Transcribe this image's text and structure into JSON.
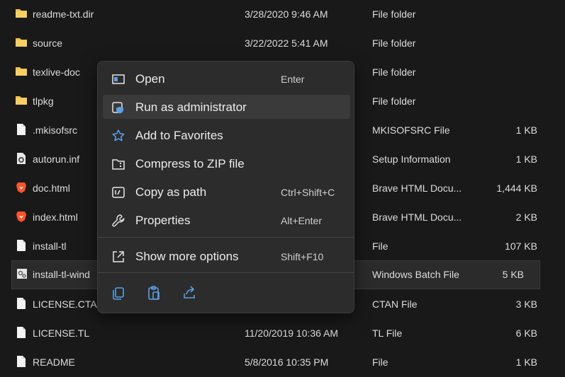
{
  "files": [
    {
      "name": "readme-txt.dir",
      "date": "3/28/2020 9:46 AM",
      "type": "File folder",
      "size": "",
      "icon": "folder-icon"
    },
    {
      "name": "source",
      "date": "3/22/2022 5:41 AM",
      "type": "File folder",
      "size": "",
      "icon": "folder-icon"
    },
    {
      "name": "texlive-doc",
      "date": "",
      "type": "File folder",
      "size": "",
      "icon": "folder-icon"
    },
    {
      "name": "tlpkg",
      "date": "",
      "type": "File folder",
      "size": "",
      "icon": "folder-icon"
    },
    {
      "name": ".mkisofsrc",
      "date": "",
      "type": "MKISOFSRC File",
      "size": "1 KB",
      "icon": "file-icon"
    },
    {
      "name": "autorun.inf",
      "date": "",
      "type": "Setup Information",
      "size": "1 KB",
      "icon": "settings-file-icon"
    },
    {
      "name": "doc.html",
      "date": "",
      "type": "Brave HTML Docu...",
      "size": "1,444 KB",
      "icon": "brave-icon"
    },
    {
      "name": "index.html",
      "date": "",
      "type": "Brave HTML Docu...",
      "size": "2 KB",
      "icon": "brave-icon"
    },
    {
      "name": "install-tl",
      "date": "",
      "type": "File",
      "size": "107 KB",
      "icon": "file-icon"
    },
    {
      "name": "install-tl-wind",
      "date": "",
      "type": "Windows Batch File",
      "size": "5 KB",
      "icon": "batch-file-icon"
    },
    {
      "name": "LICENSE.CTAN",
      "date": "",
      "type": "CTAN File",
      "size": "3 KB",
      "icon": "file-icon"
    },
    {
      "name": "LICENSE.TL",
      "date": "11/20/2019 10:36 AM",
      "type": "TL File",
      "size": "6 KB",
      "icon": "file-icon"
    },
    {
      "name": "README",
      "date": "5/8/2016 10:35 PM",
      "type": "File",
      "size": "1 KB",
      "icon": "file-icon"
    }
  ],
  "context_menu": {
    "items": [
      {
        "label": "Open",
        "shortcut": "Enter",
        "icon": "open-window-icon"
      },
      {
        "label": "Run as administrator",
        "shortcut": "",
        "icon": "shield-icon"
      },
      {
        "label": "Add to Favorites",
        "shortcut": "",
        "icon": "star-icon"
      },
      {
        "label": "Compress to ZIP file",
        "shortcut": "",
        "icon": "zip-folder-icon"
      },
      {
        "label": "Copy as path",
        "shortcut": "Ctrl+Shift+C",
        "icon": "copy-path-icon"
      },
      {
        "label": "Properties",
        "shortcut": "Alt+Enter",
        "icon": "wrench-icon"
      },
      {
        "label": "Show more options",
        "shortcut": "Shift+F10",
        "icon": "more-options-icon"
      }
    ],
    "quick_actions": [
      "copy-icon",
      "paste-icon",
      "share-icon"
    ]
  },
  "colors": {
    "background": "#191919",
    "menu": "#2c2c2c",
    "accent": "#5aa0e6",
    "folder": "#f2c14e"
  }
}
